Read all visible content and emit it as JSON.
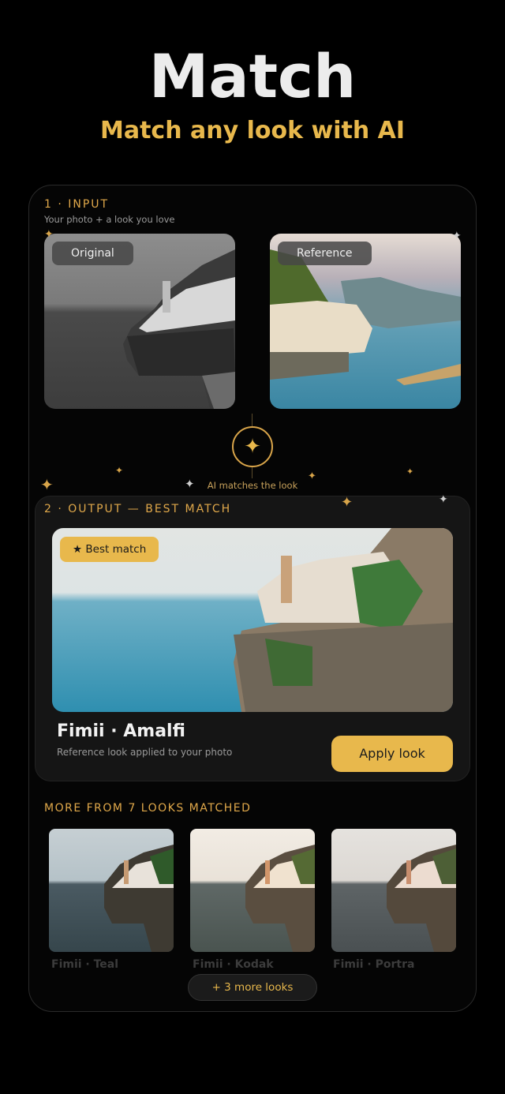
{
  "hero": {
    "title": "Match",
    "subtitle": "Match any look with AI"
  },
  "input": {
    "label": "1 · INPUT",
    "hint": "Your photo + a look you love",
    "original_chip": "Original",
    "reference_chip": "Reference"
  },
  "ai": {
    "label": "AI matches the look",
    "icon": "sparkle-icon"
  },
  "output": {
    "label": "2 · OUTPUT — BEST MATCH",
    "badge": "★ Best match",
    "look_name": "Fimii · Amalfi",
    "look_desc": "Reference look applied to your photo",
    "apply_button": "Apply look"
  },
  "more": {
    "label": "MORE FROM 7 LOOKS MATCHED",
    "looks": [
      {
        "name": "Fimii · Teal"
      },
      {
        "name": "Fimii · Kodak"
      },
      {
        "name": "Fimii · Portra"
      }
    ],
    "more_button": "+ 3 more looks"
  },
  "colors": {
    "accent": "#e8b84c",
    "background": "#000000",
    "panel": "#151515"
  }
}
